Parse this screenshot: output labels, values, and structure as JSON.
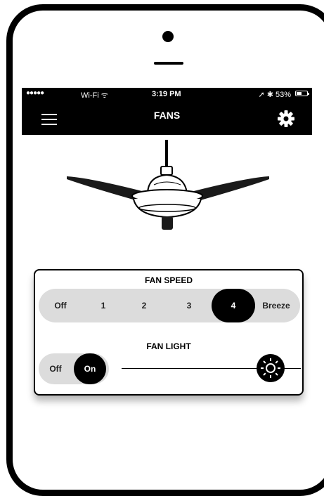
{
  "status_bar": {
    "carrier": "●●●●●",
    "wifi": "Wi-Fi ᯤ",
    "time": "3:19 PM",
    "right": "➚ ✱ 53%",
    "battery_level": 0.53
  },
  "navbar": {
    "title": "FANS",
    "menu_icon": "hamburger-icon",
    "settings_icon": "gear-icon"
  },
  "fan_speed": {
    "label": "FAN SPEED",
    "options": [
      "Off",
      "1",
      "2",
      "3",
      "4",
      "Breeze"
    ],
    "selected": "4"
  },
  "fan_light": {
    "label": "FAN LIGHT",
    "options": [
      "Off",
      "On"
    ],
    "selected": "On",
    "brightness_icon": "sun-icon",
    "brightness_level": 1.0
  },
  "colors": {
    "bar": "#000000",
    "track": "#dcdcdc",
    "active": "#000000"
  }
}
